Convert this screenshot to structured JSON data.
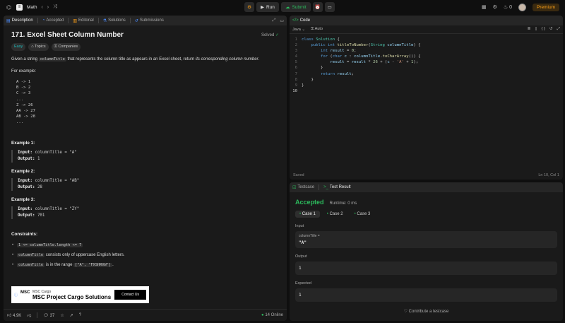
{
  "nav": {
    "list_title": "Math",
    "run_label": "Run",
    "submit_label": "Submit",
    "notification_count": "0",
    "premium_label": "Premium"
  },
  "left_tabs": [
    "Description",
    "Accepted",
    "Editorial",
    "Solutions",
    "Submissions"
  ],
  "problem": {
    "title": "171. Excel Sheet Column Number",
    "status": "Solved",
    "difficulty": "Easy",
    "topics_label": "Topics",
    "companies_label": "Companies",
    "intro_a": "Given a string ",
    "intro_code": "columnTitle",
    "intro_b": " that represents the column title as appears in an Excel sheet, return ",
    "intro_c": "its corresponding column number",
    "intro_d": ".",
    "for_example": "For example:",
    "mapping": "A -> 1\nB -> 2\nC -> 3\n...\nZ -> 26\nAA -> 27\nAB -> 28\n...",
    "examples": [
      {
        "heading": "Example 1:",
        "input": "columnTitle = \"A\"",
        "output": "1"
      },
      {
        "heading": "Example 2:",
        "input": "columnTitle = \"AB\"",
        "output": "28"
      },
      {
        "heading": "Example 3:",
        "input": "columnTitle = \"ZY\"",
        "output": "701"
      }
    ],
    "input_label": "Input:",
    "output_label": "Output:",
    "constraints_heading": "Constraints:",
    "constraints": [
      {
        "code": "1 <= columnTitle.length <= 7",
        "text": ""
      },
      {
        "code": "columnTitle",
        "text": " consists only of uppercase English letters."
      },
      {
        "code": "columnTitle",
        "text": " is in the range ",
        "code2": "[\"A\", \"FXSHRXW\"]",
        "text2": "."
      }
    ]
  },
  "ad": {
    "logo": "MSC",
    "small": "MSC Cargo",
    "big": "MSC Project Cargo Solutions",
    "button": "Contact Us"
  },
  "left_footer": {
    "likes": "4.9K",
    "comments": "37",
    "online": "14 Online"
  },
  "code_panel": {
    "title": "Code",
    "language": "Java",
    "mode": "Auto",
    "lines": [
      "class Solution {",
      "    public int titleToNumber(String columnTitle) {",
      "        int result = 0;",
      "        for (char c : columnTitle.toCharArray()) {",
      "            result = result * 26 + (c - 'A' + 1);",
      "        }",
      "        return result;",
      "    }",
      "}",
      ""
    ],
    "saved": "Saved",
    "cursor": "Ln 10, Col 1"
  },
  "test_panel": {
    "tab_testcase": "Testcase",
    "tab_result": "Test Result",
    "verdict": "Accepted",
    "runtime": "Runtime: 0 ms",
    "cases": [
      "Case 1",
      "Case 2",
      "Case 3"
    ],
    "input_label": "Input",
    "input_key": "columnTitle =",
    "input_value": "\"A\"",
    "output_label": "Output",
    "output_value": "1",
    "expected_label": "Expected",
    "expected_value": "1",
    "contribute": "Contribute a testcase"
  },
  "colors": {
    "accent_green": "#2cbb5d",
    "accent_blue": "#4a8cff",
    "premium": "#ffa116"
  }
}
